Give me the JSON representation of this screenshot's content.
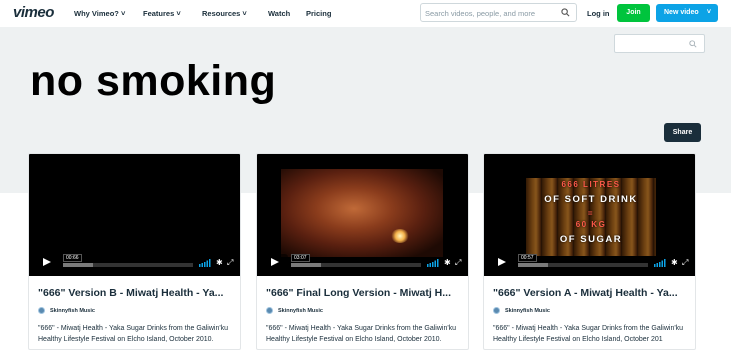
{
  "nav": {
    "logo": "vimeo",
    "items": [
      "Why Vimeo? ˅",
      "Features ˅",
      "Resources ˅",
      "Watch",
      "Pricing"
    ],
    "search_placeholder": "Search videos, people, and more",
    "login": "Log in",
    "join": "Join",
    "new_video": "New video",
    "new_video_chevron": "˅"
  },
  "hero": {
    "title": "no smoking",
    "share": "Share"
  },
  "videos": [
    {
      "title": "\"666\" Version B - Miwatj Health - Ya...",
      "owner": "Skinnyfish Music",
      "description": "\"666\" - Miwatj Health - Yaka Sugar Drinks from the Galiwin'ku Healthy Lifestyle Festival on Elcho Island, October 2010.",
      "duration": "00:66"
    },
    {
      "title": "\"666\" Final Long Version - Miwatj H...",
      "owner": "Skinnyfish Music",
      "description": "\"666\" - Miwatj Health - Yaka Sugar Drinks from the Galiwin'ku Healthy Lifestyle Festival on Elcho Island, October 2010.",
      "duration": "03:07"
    },
    {
      "title": "\"666\" Version A - Miwatj Health - Ya...",
      "owner": "Skinnyfish Music",
      "description": "\"666\" - Miwatj Health - Yaka Sugar Drinks from the Galiwin'ku Healthy Lifestyle Festival on Elcho Island, October 201",
      "duration": "00:57",
      "thumb_text": [
        "666 LITRES",
        "OF SOFT DRINK",
        "=",
        "60 KG",
        "OF SUGAR"
      ]
    }
  ],
  "colors": {
    "join": "#00c43d",
    "new_video": "#0ca3e6",
    "share": "#1a2e3b",
    "hero_bg": "#eef1f2"
  }
}
